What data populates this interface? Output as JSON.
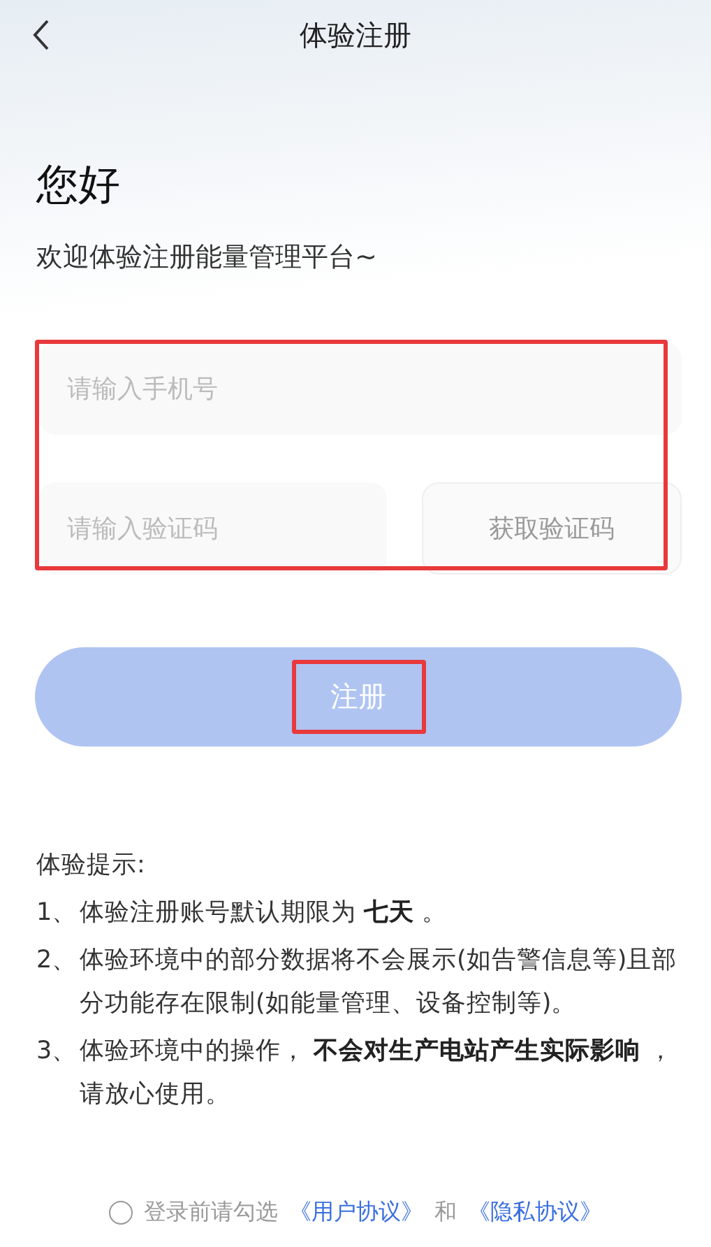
{
  "header": {
    "title": "体验注册"
  },
  "greeting": {
    "title": "您好",
    "subtitle": "欢迎体验注册能量管理平台~"
  },
  "form": {
    "phone": {
      "placeholder": "请输入手机号"
    },
    "code": {
      "placeholder": "请输入验证码"
    },
    "get_code_button": "获取验证码",
    "submit_button": "注册"
  },
  "tips": {
    "title": "体验提示:",
    "items": [
      {
        "number": "1、",
        "text": "体验注册账号默认期限为 **七天** 。"
      },
      {
        "number": "2、",
        "text": "体验环境中的部分数据将不会展示(如告警信息等)且部分功能存在限制(如能量管理、设备控制等)。"
      },
      {
        "number": "3、",
        "text": "体验环境中的操作， **不会对生产电站产生实际影响** ，请放心使用。"
      }
    ]
  },
  "agreement": {
    "checked": false,
    "prefix": "登录前请勾选",
    "links": [
      "《用户协议》",
      "《隐私协议》"
    ],
    "conjunction": "和"
  }
}
